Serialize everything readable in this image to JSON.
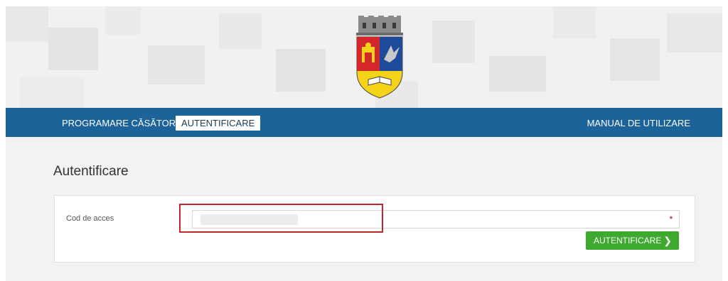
{
  "header": {
    "crest_alt": "city-coat-of-arms",
    "colors": {
      "banner_bg": "#f1f1f1",
      "navbar_bg": "#1b6399"
    }
  },
  "nav": {
    "items": [
      {
        "label": "PROGRAMARE CĂSĂTORII"
      },
      {
        "label": "AUTENTIFICARE",
        "active": true
      }
    ],
    "manual_label": "MANUAL DE UTILIZARE"
  },
  "main": {
    "title": "Autentificare",
    "form": {
      "access_code_label": "Cod de acces",
      "access_code_value": "",
      "required_mark": "*",
      "submit_label": "AUTENTIFICARE",
      "submit_icon": "chevron-right-icon",
      "submit_color": "#3ea92f"
    }
  }
}
